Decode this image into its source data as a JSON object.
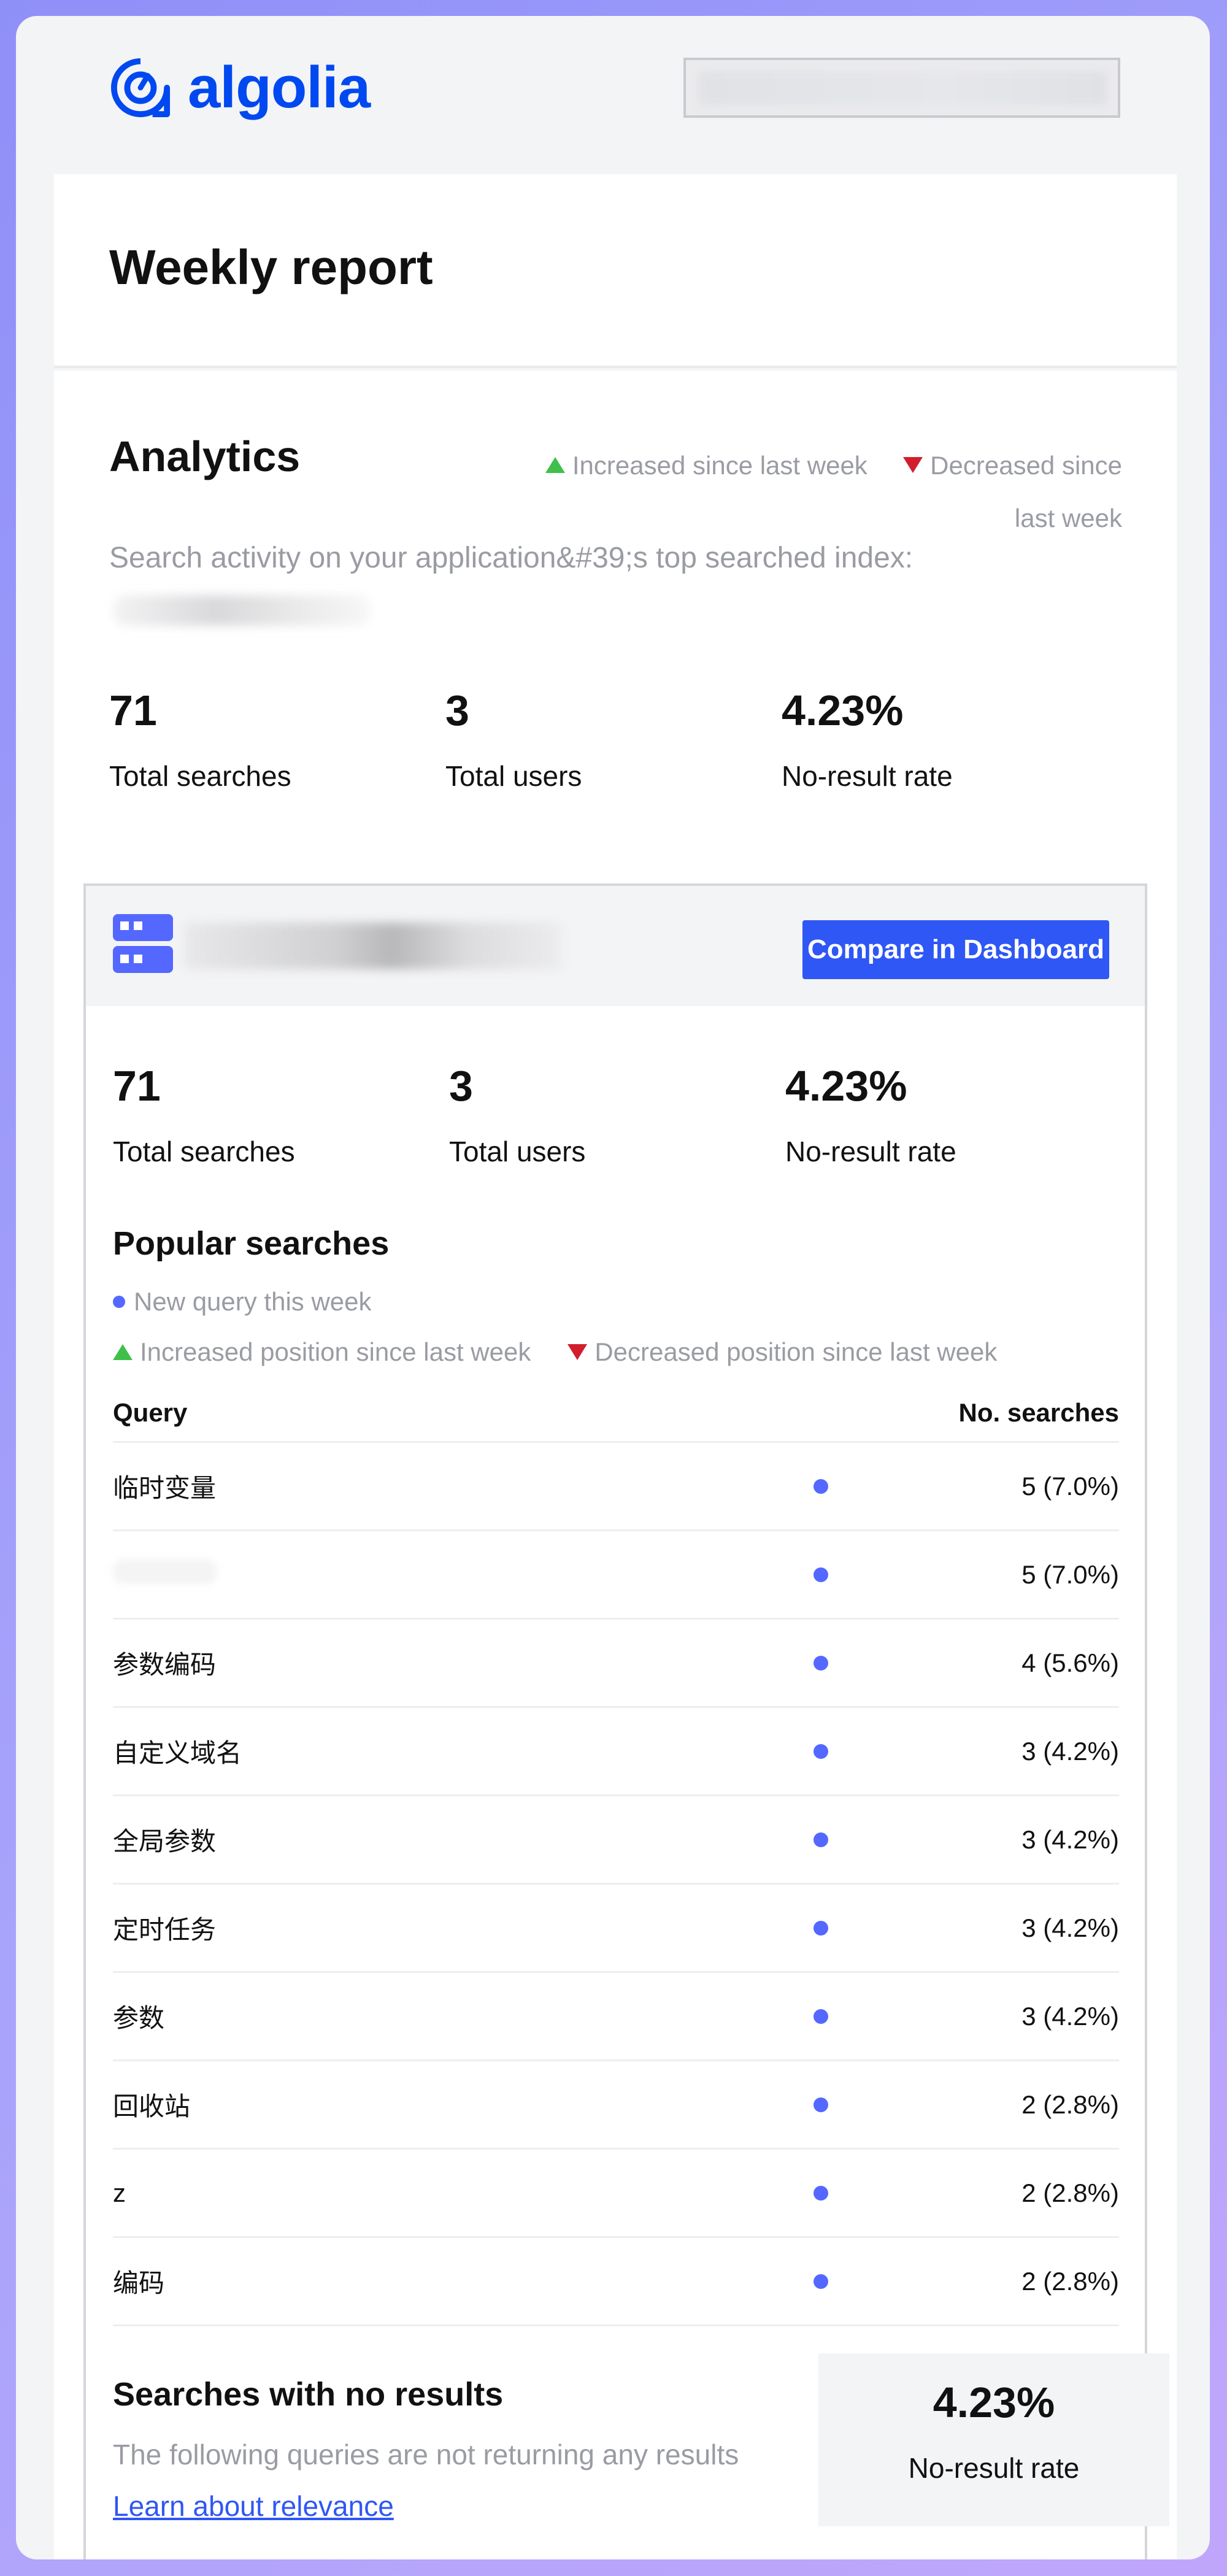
{
  "header": {
    "logo_text": "algolia"
  },
  "title_card": {
    "title": "Weekly report"
  },
  "analytics": {
    "title": "Analytics",
    "legend_increased": "Increased since last week",
    "legend_decreased": "Decreased since last week",
    "subtitle": "Search activity on your application&#39;s top searched index:",
    "stats": [
      {
        "value": "71",
        "label": "Total searches"
      },
      {
        "value": "3",
        "label": "Total users"
      },
      {
        "value": "4.23%",
        "label": "No-result rate"
      }
    ]
  },
  "index_panel": {
    "compare_button": "Compare in Dashboard",
    "stats": [
      {
        "value": "71",
        "label": "Total searches"
      },
      {
        "value": "3",
        "label": "Total users"
      },
      {
        "value": "4.23%",
        "label": "No-result rate"
      }
    ],
    "popular": {
      "title": "Popular searches",
      "legend_new": "New query this week",
      "legend_increased": "Increased position since last week",
      "legend_decreased": "Decreased position since last week",
      "col_query": "Query",
      "col_searches": "No. searches",
      "rows": [
        {
          "query": "临时变量",
          "count": "5 (7.0%)"
        },
        {
          "query": "",
          "count": "5 (7.0%)"
        },
        {
          "query": "参数编码",
          "count": "4 (5.6%)"
        },
        {
          "query": "自定义域名",
          "count": "3 (4.2%)"
        },
        {
          "query": "全局参数",
          "count": "3 (4.2%)"
        },
        {
          "query": "定时任务",
          "count": "3 (4.2%)"
        },
        {
          "query": "参数",
          "count": "3 (4.2%)"
        },
        {
          "query": "回收站",
          "count": "2 (2.8%)"
        },
        {
          "query": "z",
          "count": "2 (2.8%)"
        },
        {
          "query": "编码",
          "count": "2 (2.8%)"
        }
      ]
    },
    "no_results": {
      "title": "Searches with no results",
      "text": "The following queries are not returning any results",
      "link": "Learn about relevance",
      "rate_value": "4.23%",
      "rate_label": "No-result rate"
    }
  },
  "colors": {
    "brand": "#0048f0",
    "button": "#2f57f5",
    "new_dot": "#5468ff",
    "increase": "#3fc04a",
    "decrease": "#d11e2c"
  }
}
